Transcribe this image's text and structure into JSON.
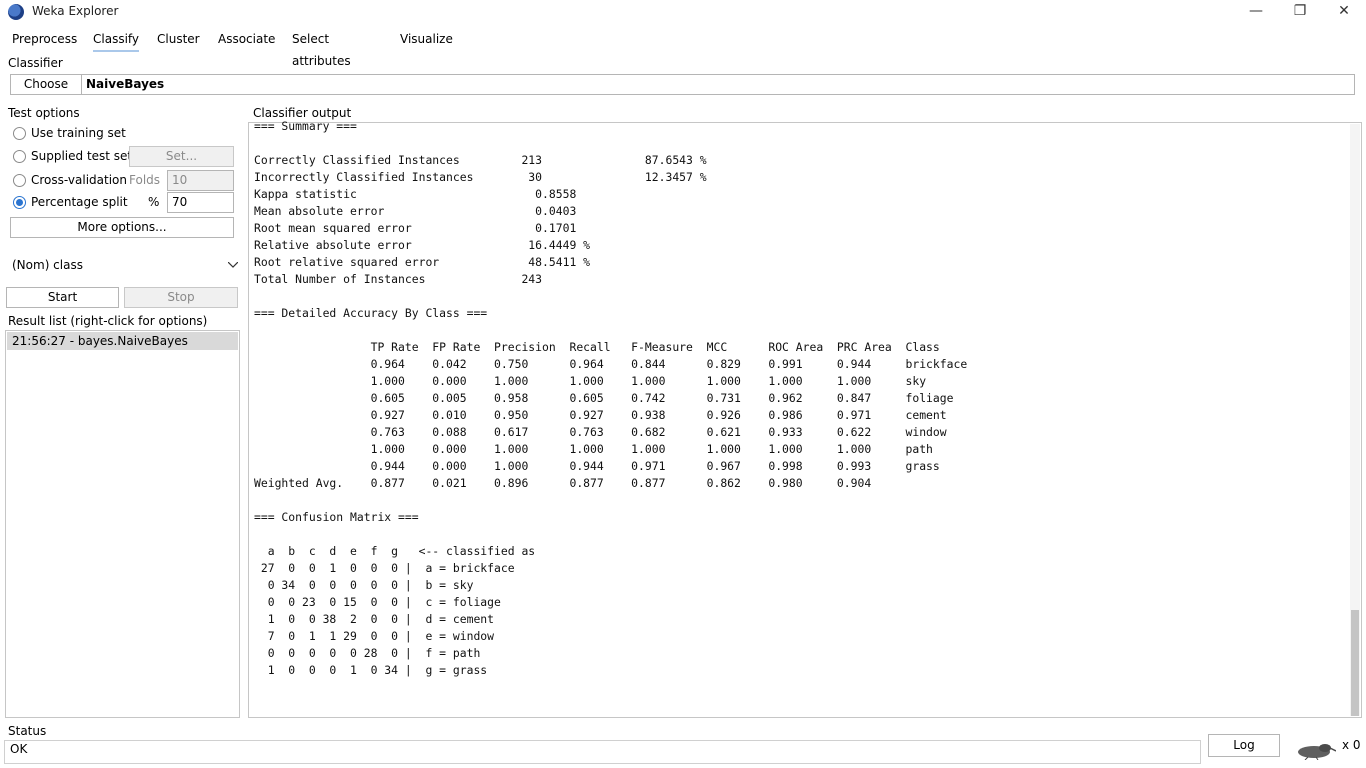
{
  "window": {
    "title": "Weka Explorer",
    "controls": {
      "minimize": "—",
      "maximize": "❐",
      "close": "✕"
    }
  },
  "tabs": [
    "Preprocess",
    "Classify",
    "Cluster",
    "Associate",
    "Select attributes",
    "Visualize"
  ],
  "active_tab": "Classify",
  "classifier": {
    "section_label": "Classifier",
    "choose_label": "Choose",
    "name": "NaiveBayes"
  },
  "test_options": {
    "section_label": "Test options",
    "use_training_set": "Use training set",
    "supplied_test_set": "Supplied test set",
    "set_button": "Set...",
    "cross_validation": "Cross-validation",
    "folds_label": "Folds",
    "folds_value": "10",
    "percentage_split": "Percentage split",
    "percent_label": "%",
    "percent_value": "70",
    "selected": "Percentage split",
    "more_options": "More options..."
  },
  "class_select": {
    "value": "(Nom) class"
  },
  "actions": {
    "start": "Start",
    "stop": "Stop"
  },
  "result_list": {
    "label": "Result list (right-click for options)",
    "items": [
      "21:56:27 - bayes.NaiveBayes"
    ]
  },
  "output": {
    "label": "Classifier output",
    "lines": [
      "=== Summary ===",
      "",
      "Correctly Classified Instances         213               87.6543 %",
      "Incorrectly Classified Instances        30               12.3457 %",
      "Kappa statistic                          0.8558",
      "Mean absolute error                      0.0403",
      "Root mean squared error                  0.1701",
      "Relative absolute error                 16.4449 %",
      "Root relative squared error             48.5411 %",
      "Total Number of Instances              243     ",
      "",
      "=== Detailed Accuracy By Class ===",
      "",
      "                 TP Rate  FP Rate  Precision  Recall   F-Measure  MCC      ROC Area  PRC Area  Class",
      "                 0.964    0.042    0.750      0.964    0.844      0.829    0.991     0.944     brickface",
      "                 1.000    0.000    1.000      1.000    1.000      1.000    1.000     1.000     sky",
      "                 0.605    0.005    0.958      0.605    0.742      0.731    0.962     0.847     foliage",
      "                 0.927    0.010    0.950      0.927    0.938      0.926    0.986     0.971     cement",
      "                 0.763    0.088    0.617      0.763    0.682      0.621    0.933     0.622     window",
      "                 1.000    0.000    1.000      1.000    1.000      1.000    1.000     1.000     path",
      "                 0.944    0.000    1.000      0.944    0.971      0.967    0.998     0.993     grass",
      "Weighted Avg.    0.877    0.021    0.896      0.877    0.877      0.862    0.980     0.904     ",
      "",
      "=== Confusion Matrix ===",
      "",
      "  a  b  c  d  e  f  g   <-- classified as",
      " 27  0  0  1  0  0  0 |  a = brickface",
      "  0 34  0  0  0  0  0 |  b = sky",
      "  0  0 23  0 15  0  0 |  c = foliage",
      "  1  0  0 38  2  0  0 |  d = cement",
      "  7  0  1  1 29  0  0 |  e = window",
      "  0  0  0  0  0 28  0 |  f = path",
      "  1  0  0  0  1  0 34 |  g = grass"
    ]
  },
  "status": {
    "label": "Status",
    "text": "OK",
    "log_button": "Log",
    "counter": "x 0"
  }
}
